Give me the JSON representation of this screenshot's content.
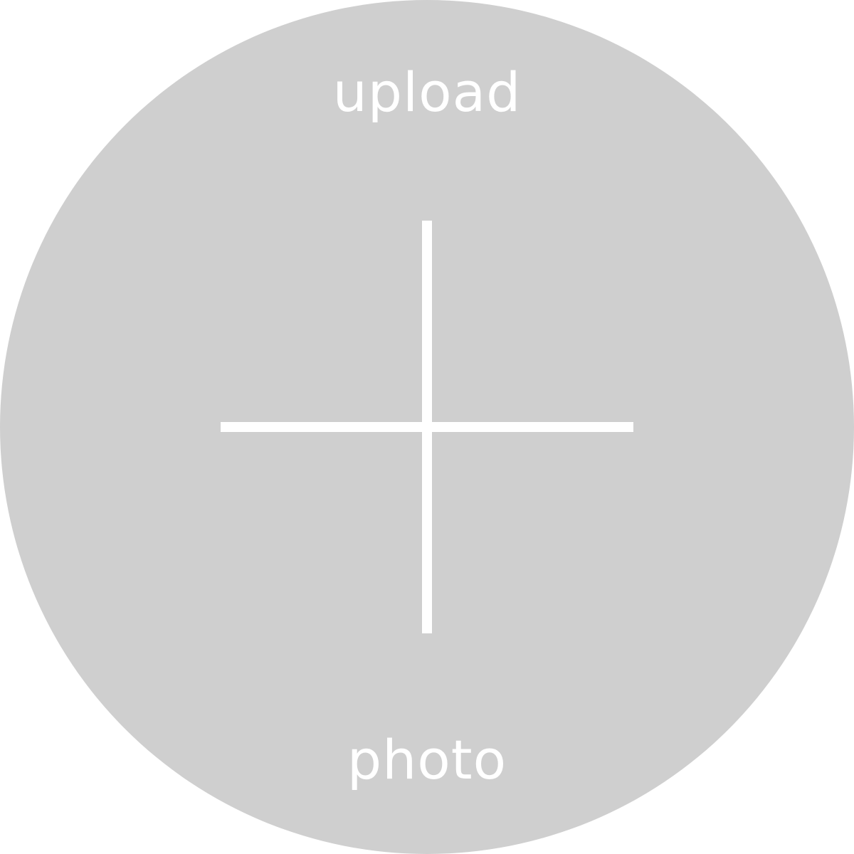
{
  "upload": {
    "top_label": "upload",
    "bottom_label": "photo",
    "icon": "plus-icon"
  },
  "colors": {
    "circle_fill": "#cfcfcf",
    "foreground": "#ffffff"
  }
}
